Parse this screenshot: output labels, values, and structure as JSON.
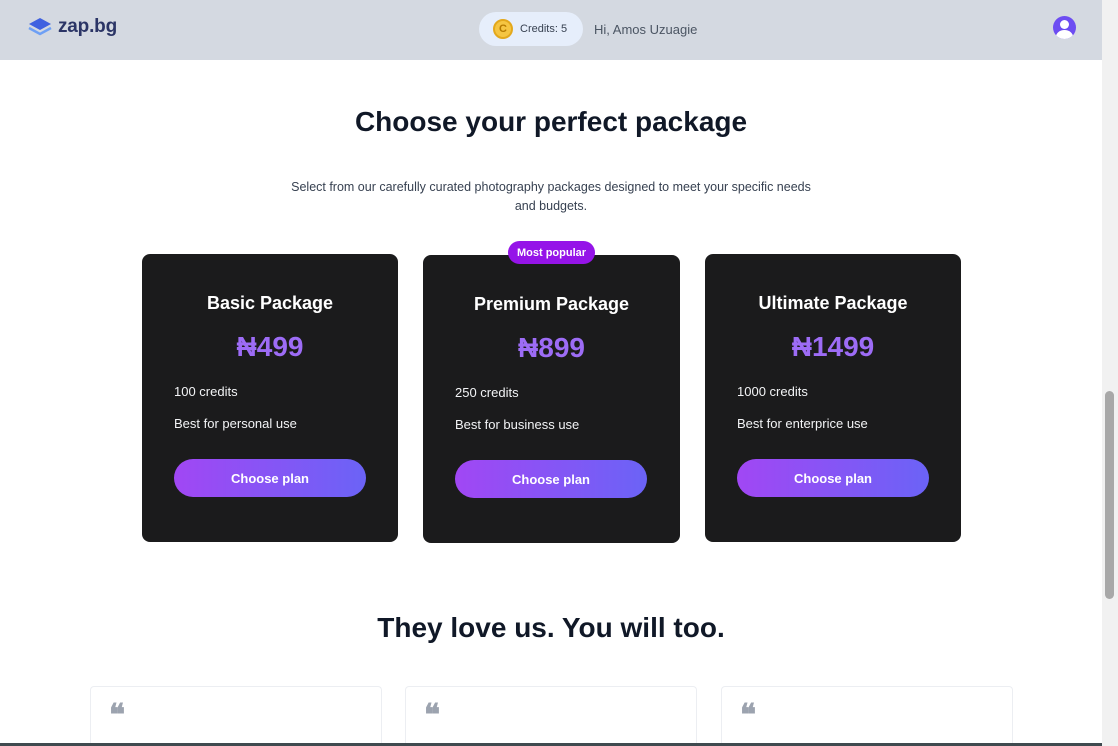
{
  "header": {
    "logo_text": "zap",
    "logo_suffix": ".bg",
    "credits_label": "Credits: 5",
    "greeting": "Hi, Amos Uzuagie"
  },
  "main": {
    "title": "Choose your perfect package",
    "subtitle": "Select from our carefully curated photography packages designed to meet your specific needs and budgets.",
    "popular_badge": "Most popular",
    "packages": [
      {
        "name": "Basic Package",
        "price": "₦499",
        "credits": "100 credits",
        "use": "Best for personal use",
        "button": "Choose plan"
      },
      {
        "name": "Premium Package",
        "price": "₦899",
        "credits": "250 credits",
        "use": "Best for business use",
        "button": "Choose plan"
      },
      {
        "name": "Ultimate Package",
        "price": "₦1499",
        "credits": "1000 credits",
        "use": "Best for enterprice use",
        "button": "Choose plan"
      }
    ],
    "testimonials_title": "They love us. You will too.",
    "quote_glyph": "❝"
  },
  "colors": {
    "accent": "#9d6cf6",
    "badge": "#9514e8",
    "card_bg": "#1b1b1c",
    "header_bg": "#d4d9e1"
  }
}
